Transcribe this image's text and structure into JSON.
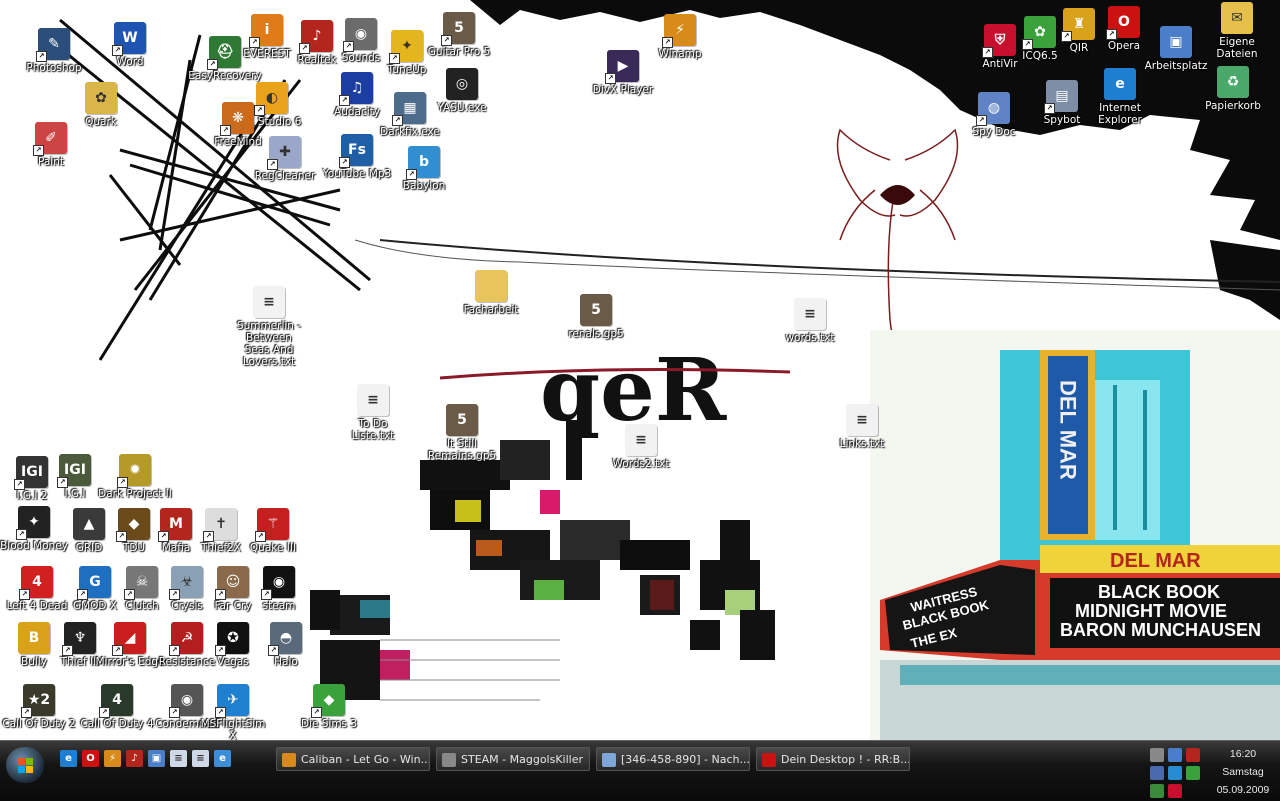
{
  "desktop": {
    "icons": [
      {
        "label": "Photoshop",
        "color": "#2b4f7a",
        "glyph": "✎",
        "shortcut": true
      },
      {
        "label": "Word",
        "color": "#1f54b3",
        "glyph": "W",
        "shortcut": true
      },
      {
        "label": "EasyRecovery",
        "color": "#2e7a34",
        "glyph": "⛑",
        "shortcut": true
      },
      {
        "label": "EVEREST",
        "color": "#e07b1a",
        "glyph": "i",
        "shortcut": true
      },
      {
        "label": "Realtek",
        "color": "#b3261e",
        "glyph": "♪",
        "shortcut": true
      },
      {
        "label": "Sounds",
        "color": "#6b6b6b",
        "glyph": "◉",
        "shortcut": true
      },
      {
        "label": "TuneUp",
        "color": "#e5b51e",
        "glyph": "✦",
        "shortcut": true
      },
      {
        "label": "Guitar Pro 5",
        "color": "#6a5a48",
        "glyph": "5",
        "shortcut": true
      },
      {
        "label": "YASU.exe",
        "color": "#222222",
        "glyph": "◎",
        "shortcut": false
      },
      {
        "label": "Quark",
        "color": "#d9b54a",
        "glyph": "✿",
        "shortcut": false
      },
      {
        "label": "FL Studio 6",
        "color": "#e9a21a",
        "glyph": "◐",
        "shortcut": true
      },
      {
        "label": "Audacity",
        "color": "#1b3ea0",
        "glyph": "♫",
        "shortcut": true
      },
      {
        "label": "Darkfix.exe",
        "color": "#4d6b8a",
        "glyph": "▦",
        "shortcut": true
      },
      {
        "label": "Paint",
        "color": "#c44",
        "glyph": "✐",
        "shortcut": true
      },
      {
        "label": "FreeMind",
        "color": "#c96a1c",
        "glyph": "❋",
        "shortcut": true
      },
      {
        "label": "RegCleaner",
        "color": "#9aa7c9",
        "glyph": "✚",
        "shortcut": true
      },
      {
        "label": "YouTube Mp3",
        "color": "#1f5fa6",
        "glyph": "Fs",
        "shortcut": true
      },
      {
        "label": "Babylon",
        "color": "#2f8fd1",
        "glyph": "b",
        "shortcut": true
      },
      {
        "label": "Winamp",
        "color": "#d88a1a",
        "glyph": "⚡",
        "shortcut": true
      },
      {
        "label": "DivX Player",
        "color": "#3a2a5a",
        "glyph": "▶",
        "shortcut": true
      },
      {
        "label": "AntiVir",
        "color": "#c8102e",
        "glyph": "⛨",
        "shortcut": true
      },
      {
        "label": "ICQ6.5",
        "color": "#3aa23a",
        "glyph": "✿",
        "shortcut": true
      },
      {
        "label": "QIR",
        "color": "#d9a21a",
        "glyph": "♜",
        "shortcut": true
      },
      {
        "label": "Opera",
        "color": "#cc1111",
        "glyph": "O",
        "shortcut": true
      },
      {
        "label": "Arbeitsplatz",
        "color": "#4a7ec8",
        "glyph": "▣",
        "shortcut": false
      },
      {
        "label": "Eigene Dateien",
        "color": "#e6c04a",
        "glyph": "✉",
        "shortcut": false
      },
      {
        "label": "Internet Explorer",
        "color": "#1e7ed0",
        "glyph": "e",
        "shortcut": false
      },
      {
        "label": "Papierkorb",
        "color": "#4aa86b",
        "glyph": "♻",
        "shortcut": false
      },
      {
        "label": "Spy Doc",
        "color": "#5f83c5",
        "glyph": "◍",
        "shortcut": true
      },
      {
        "label": "Spybot",
        "color": "#7e8ea6",
        "glyph": "▤",
        "shortcut": true
      },
      {
        "label": "Summerlin - Between Seas And Lovers.txt",
        "color": "#f2f2f2",
        "glyph": "≡",
        "shortcut": false
      },
      {
        "label": "Facharbeit",
        "color": "#e8c45a",
        "glyph": "",
        "shortcut": false
      },
      {
        "label": "renals.gp5",
        "color": "#6a5a48",
        "glyph": "5",
        "shortcut": false
      },
      {
        "label": "words.txt",
        "color": "#f2f2f2",
        "glyph": "≡",
        "shortcut": false
      },
      {
        "label": "To Do Liste.txt",
        "color": "#f2f2f2",
        "glyph": "≡",
        "shortcut": false
      },
      {
        "label": "It Still Remains.gp5",
        "color": "#6a5a48",
        "glyph": "5",
        "shortcut": false
      },
      {
        "label": "Words2.txt",
        "color": "#f2f2f2",
        "glyph": "≡",
        "shortcut": false
      },
      {
        "label": "Links.txt",
        "color": "#f2f2f2",
        "glyph": "≡",
        "shortcut": false
      },
      {
        "label": "I.G.I 2",
        "color": "#333333",
        "glyph": "IGI",
        "shortcut": true
      },
      {
        "label": "I.G.I",
        "color": "#4a5a3a",
        "glyph": "IGI",
        "shortcut": true
      },
      {
        "label": "Dark Project II",
        "color": "#b59a2a",
        "glyph": "✹",
        "shortcut": true
      },
      {
        "label": "Blood Money",
        "color": "#222222",
        "glyph": "✦",
        "shortcut": true
      },
      {
        "label": "GRID",
        "color": "#3a3a3a",
        "glyph": "▲",
        "shortcut": false
      },
      {
        "label": "TDU",
        "color": "#6b4a1a",
        "glyph": "◆",
        "shortcut": true
      },
      {
        "label": "Mafia",
        "color": "#b3261e",
        "glyph": "M",
        "shortcut": true
      },
      {
        "label": "Thief2X",
        "color": "#dddddd",
        "glyph": "✝",
        "shortcut": true
      },
      {
        "label": "Quake III",
        "color": "#c42020",
        "glyph": "⚚",
        "shortcut": true
      },
      {
        "label": "Left 4 Dead",
        "color": "#d02020",
        "glyph": "4",
        "shortcut": true
      },
      {
        "label": "GMOD X",
        "color": "#1f6fc0",
        "glyph": "G",
        "shortcut": true
      },
      {
        "label": "Clutch",
        "color": "#777777",
        "glyph": "☠",
        "shortcut": true
      },
      {
        "label": "Crysis",
        "color": "#8aa0b5",
        "glyph": "☣",
        "shortcut": true
      },
      {
        "label": "Far Cry",
        "color": "#8a6a4a",
        "glyph": "☺",
        "shortcut": true
      },
      {
        "label": "steam",
        "color": "#111111",
        "glyph": "◉",
        "shortcut": true
      },
      {
        "label": "Bully",
        "color": "#d9a21a",
        "glyph": "B",
        "shortcut": false
      },
      {
        "label": "Thief III",
        "color": "#222222",
        "glyph": "♆",
        "shortcut": true
      },
      {
        "label": "Mirror's Edge",
        "color": "#c81e1e",
        "glyph": "◢",
        "shortcut": true
      },
      {
        "label": "Resistance",
        "color": "#b31e1e",
        "glyph": "☭",
        "shortcut": true
      },
      {
        "label": "Vegas",
        "color": "#111111",
        "glyph": "✪",
        "shortcut": true
      },
      {
        "label": "Halo",
        "color": "#5a6a7a",
        "glyph": "◓",
        "shortcut": true
      },
      {
        "label": "Call Of Duty 2",
        "color": "#3a3a2a",
        "glyph": "★2",
        "shortcut": true
      },
      {
        "label": "Call Of Duty 4",
        "color": "#2a3a2a",
        "glyph": "4",
        "shortcut": true
      },
      {
        "label": "Condemned",
        "color": "#555555",
        "glyph": "◉",
        "shortcut": true
      },
      {
        "label": "MSFlightSim X",
        "color": "#1f80d0",
        "glyph": "✈",
        "shortcut": true
      },
      {
        "label": "Die Sims 3",
        "color": "#3aa23a",
        "glyph": "◆",
        "shortcut": true
      }
    ]
  },
  "wallpaper": {
    "marquee_sign": "DEL MAR",
    "marquee_lines": [
      "BLACK BOOK",
      "MIDNIGHT MOVIE",
      "BARON MUNCHAUSEN"
    ],
    "side_lines": [
      "WAITRESS",
      "BLACK BOOK",
      "THE EX"
    ],
    "vertical_sign": "DEL MAR",
    "logo_text": "qeR"
  },
  "taskbar": {
    "quick_launch": [
      {
        "name": "ie",
        "color": "#1e7ed0",
        "glyph": "e"
      },
      {
        "name": "opera",
        "color": "#cc1111",
        "glyph": "O"
      },
      {
        "name": "winamp",
        "color": "#d88a1a",
        "glyph": "⚡"
      },
      {
        "name": "sound",
        "color": "#b3261e",
        "glyph": "♪"
      },
      {
        "name": "desktop",
        "color": "#4a7ec8",
        "glyph": "▣"
      },
      {
        "name": "notes",
        "color": "#cfd8e6",
        "glyph": "≡"
      },
      {
        "name": "notes2",
        "color": "#cfd8e6",
        "glyph": "≡"
      },
      {
        "name": "ie2",
        "color": "#3b8fd9",
        "glyph": "e"
      }
    ],
    "tasks": [
      {
        "label": "Caliban - Let Go - Win...",
        "color": "#d88a1a"
      },
      {
        "label": "STEAM - MaggolsKiller",
        "color": "#888888"
      },
      {
        "label": "[346-458-890] - Nach...",
        "color": "#7fa6d9"
      },
      {
        "label": "Dein Desktop ! - RR:B...",
        "color": "#cc1111"
      }
    ],
    "clock": {
      "time": "16:20",
      "day": "Samstag",
      "date": "05.09.2009"
    }
  }
}
